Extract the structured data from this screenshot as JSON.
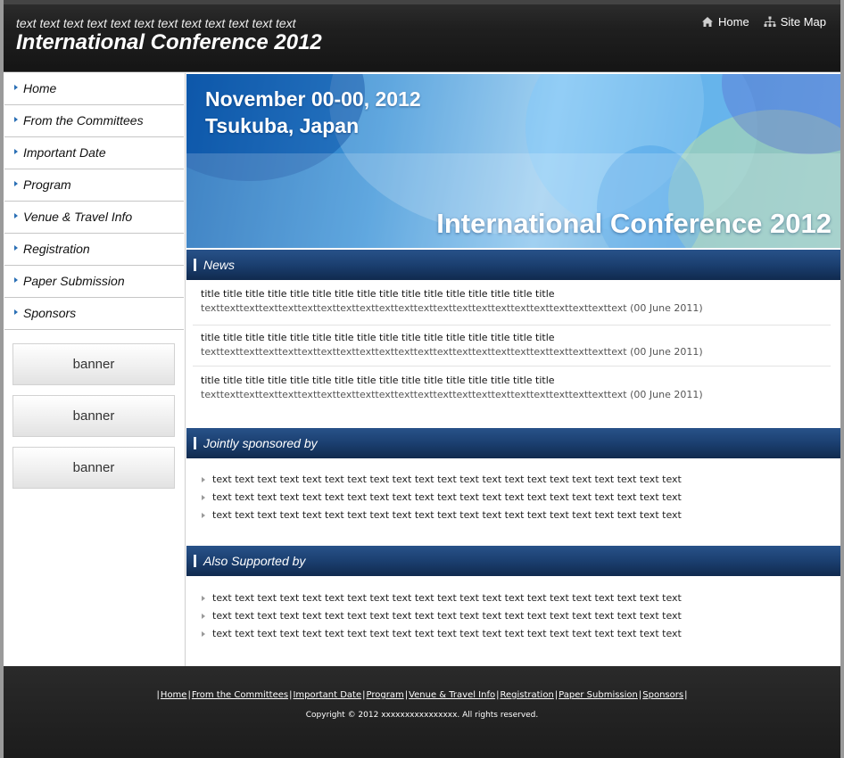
{
  "header": {
    "tagline": "text text text text text text text text text text text text",
    "title": "International Conference 2012",
    "links": [
      {
        "icon": "home-icon",
        "label": "Home"
      },
      {
        "icon": "sitemap-icon",
        "label": "Site Map"
      }
    ]
  },
  "sidebar": {
    "items": [
      {
        "label": "Home"
      },
      {
        "label": "From the Committees"
      },
      {
        "label": "Important Date"
      },
      {
        "label": "Program"
      },
      {
        "label": "Venue & Travel Info"
      },
      {
        "label": "Registration"
      },
      {
        "label": "Paper Submission"
      },
      {
        "label": "Sponsors"
      }
    ],
    "banners": [
      "banner",
      "banner",
      "banner"
    ]
  },
  "hero": {
    "date": "November 00-00, 2012",
    "place": "Tsukuba, Japan",
    "title": "International Conference 2012"
  },
  "news": {
    "heading": "News",
    "items": [
      {
        "title": "title title title title title title title title title title title title title title title title",
        "body": "texttexttexttexttexttexttexttexttexttexttexttexttexttexttexttexttexttexttexttexttexttext (00 June 2011)"
      },
      {
        "title": "title title title title title title title title title title title title title title title title",
        "body": "texttexttexttexttexttexttexttexttexttexttexttexttexttexttexttexttexttexttexttexttexttext (00 June 2011)"
      },
      {
        "title": "title title title title title title title title title title title title title title title title",
        "body": "texttexttexttexttexttexttexttexttexttexttexttexttexttexttexttexttexttexttexttexttexttext (00 June 2011)"
      }
    ]
  },
  "sponsored": {
    "heading": "Jointly sponsored by",
    "items": [
      "text text text text text text text text text text text text text text text text text text text text text",
      "text text text text text text text text text text text text text text text text text text text text text",
      "text text text text text text text text text text text text text text text text text text text text text"
    ]
  },
  "supported": {
    "heading": "Also Supported by",
    "items": [
      "text text text text text text text text text text text text text text text text text text text text text",
      "text text text text text text text text text text text text text text text text text text text text text",
      "text text text text text text text text text text text text text text text text text text text text text"
    ]
  },
  "footer": {
    "links": [
      "Home",
      "From the Committees",
      "Important Date",
      "Program",
      "Venue & Travel Info",
      "Registration",
      "Paper Submission",
      "Sponsors"
    ],
    "copyright": "Copyright © 2012 xxxxxxxxxxxxxxxx. All rights reserved."
  },
  "colors": {
    "header_bg": "#1f1f1f",
    "section_head": "#1b3f70",
    "nav_bullet": "#2a6fb5",
    "footer_bg": "#222222"
  }
}
